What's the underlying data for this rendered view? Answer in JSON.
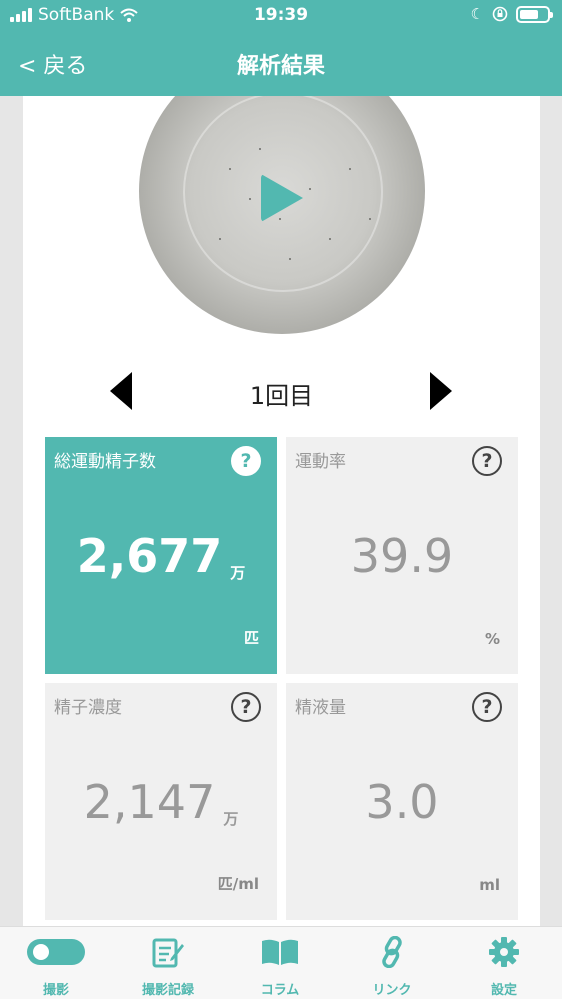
{
  "status": {
    "carrier": "SoftBank",
    "time": "19:39"
  },
  "nav": {
    "back_label": "< 戻る",
    "title": "解析結果"
  },
  "round": {
    "label": "1回目"
  },
  "tiles": [
    {
      "title": "総運動精子数",
      "value": "2,677",
      "value_unit": "万",
      "unit": "匹"
    },
    {
      "title": "運動率",
      "value": "39.9",
      "value_unit": "",
      "unit": "%"
    },
    {
      "title": "精子濃度",
      "value": "2,147",
      "value_unit": "万",
      "unit": "匹/ml"
    },
    {
      "title": "精液量",
      "value": "3.0",
      "value_unit": "",
      "unit": "ml"
    }
  ],
  "help_symbol": "?",
  "tabs": [
    {
      "label": "撮影",
      "icon": "toggle-icon"
    },
    {
      "label": "撮影記録",
      "icon": "edit-note-icon"
    },
    {
      "label": "コラム",
      "icon": "book-icon"
    },
    {
      "label": "リンク",
      "icon": "link-icon"
    },
    {
      "label": "設定",
      "icon": "gear-icon"
    }
  ],
  "colors": {
    "accent": "#52b8b0",
    "tile_bg": "#f0f0f0"
  }
}
